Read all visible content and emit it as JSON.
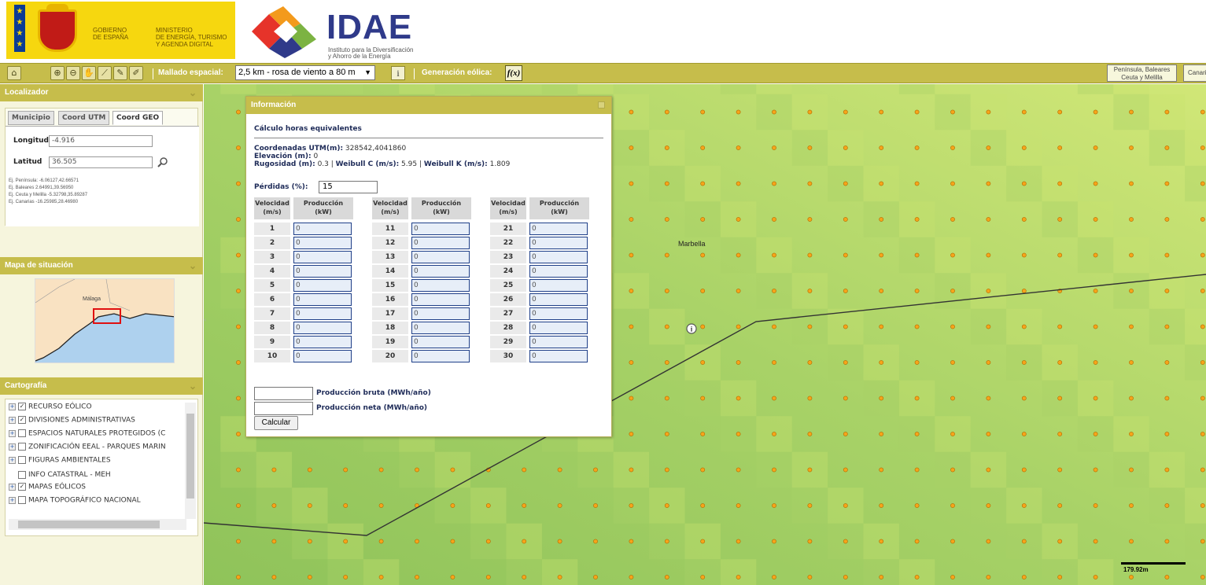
{
  "header": {
    "gov_line": "GOBIERNO\nDE ESPAÑA",
    "ministry_line": "MINISTERIO\nDE ENERGÍA, TURISMO\nY AGENDA DIGITAL",
    "idae_title": "IDAE",
    "idae_sub": "Instituto para la Diversificación\ny Ahorro de la Energía"
  },
  "toolbar": {
    "tools": [
      "home-icon",
      "zoom-in-icon",
      "zoom-out-icon",
      "pan-hand-icon",
      "measure-icon",
      "draw-icon",
      "erase-icon"
    ],
    "mallado_label": "Mallado espacial:",
    "mallado_value": "2,5 km - rosa de viento a 80 m",
    "info_button": "i",
    "generacion_label": "Generación eólica:",
    "fx_button": "f(x)",
    "region_button": "Península, Baleares\nCeuta y Melilla",
    "region_button_2": "Canarias"
  },
  "localizador": {
    "title": "Localizador",
    "tabs": [
      "Municipio",
      "Coord UTM",
      "Coord GEO"
    ],
    "active_tab": "Coord GEO",
    "longitud_label": "Longitud",
    "longitud_value": "-4.916",
    "latitud_label": "Latitud",
    "latitud_value": "36.505",
    "examples": [
      "Ej. Península: -6.06127,42.66571",
      "Ej. Baleares 2.64991,39.56950",
      "Ej. Ceuta y Melilla -5.32798,35.89287",
      "Ej. Canarias -16.25985,28.46980"
    ]
  },
  "situacion": {
    "title": "Mapa de situación",
    "city_label": "Málaga"
  },
  "cartografia": {
    "title": "Cartografía",
    "layers": [
      {
        "label": "RECURSO EÓLICO",
        "expandable": true,
        "checked": true
      },
      {
        "label": "DIVISIONES ADMINISTRATIVAS",
        "expandable": true,
        "checked": true
      },
      {
        "label": "ESPACIOS NATURALES PROTEGIDOS (C",
        "expandable": true,
        "checked": false
      },
      {
        "label": "ZONIFICACIÓN EEAL - PARQUES MARIN",
        "expandable": true,
        "checked": false
      },
      {
        "label": "FIGURAS AMBIENTALES",
        "expandable": true,
        "checked": false
      },
      {
        "label": "INFO CATASTRAL - MEH",
        "expandable": false,
        "checked": false
      },
      {
        "label": "MAPAS EÓLICOS",
        "expandable": true,
        "checked": true
      },
      {
        "label": "MAPA TOPOGRÁFICO NACIONAL",
        "expandable": true,
        "checked": false
      }
    ]
  },
  "dialog": {
    "title": "Información",
    "subtitle": "Cálculo horas equivalentes",
    "coord_label": "Coordenadas UTM(m):",
    "coord_value": " 328542,4041860",
    "elev_label": "Elevación (m):",
    "elev_value": " 0",
    "rug_label": "Rugosidad (m):",
    "rug_value": " 0.3 | ",
    "weibull_c_label": "Weibull C (m/s):",
    "weibull_c_value": " 5.95 | ",
    "weibull_k_label": "Weibull K (m/s):",
    "weibull_k_value": " 1.809",
    "perdidas_label": "Pérdidas (%):",
    "perdidas_value": "15",
    "col_velocidad": "Velocidad\n(m/s)",
    "col_produccion": "Producción\n(kW)",
    "speeds": [
      "1",
      "2",
      "3",
      "4",
      "5",
      "6",
      "7",
      "8",
      "9",
      "10",
      "11",
      "12",
      "13",
      "14",
      "15",
      "16",
      "17",
      "18",
      "19",
      "20",
      "21",
      "22",
      "23",
      "24",
      "25",
      "26",
      "27",
      "28",
      "29",
      "30"
    ],
    "production_value": "0",
    "bruta_label": "Producción bruta (MWh/año)",
    "neta_label": "Producción neta (MWh/año)",
    "calc_button": "Calcular"
  },
  "map": {
    "place_label": "Marbella",
    "scale_label": "179.92m",
    "colors": {
      "land": "#a8d267",
      "land_light": "#c9e271",
      "dot": "#f6a41a",
      "dot_border": "#b06a00"
    }
  }
}
